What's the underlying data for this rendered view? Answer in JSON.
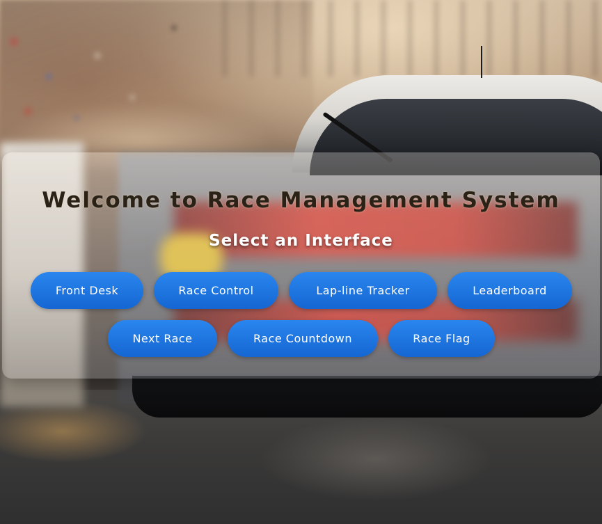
{
  "header": {
    "title": "Welcome to Race Management System",
    "subtitle": "Select an Interface"
  },
  "interfaces": [
    {
      "label": "Front Desk"
    },
    {
      "label": "Race Control"
    },
    {
      "label": "Lap-line Tracker"
    },
    {
      "label": "Leaderboard"
    },
    {
      "label": "Next Race"
    },
    {
      "label": "Race Countdown"
    },
    {
      "label": "Race Flag"
    }
  ],
  "colors": {
    "button": "#1e74e0",
    "title": "#2a2117",
    "subtitle": "#ffffff"
  }
}
